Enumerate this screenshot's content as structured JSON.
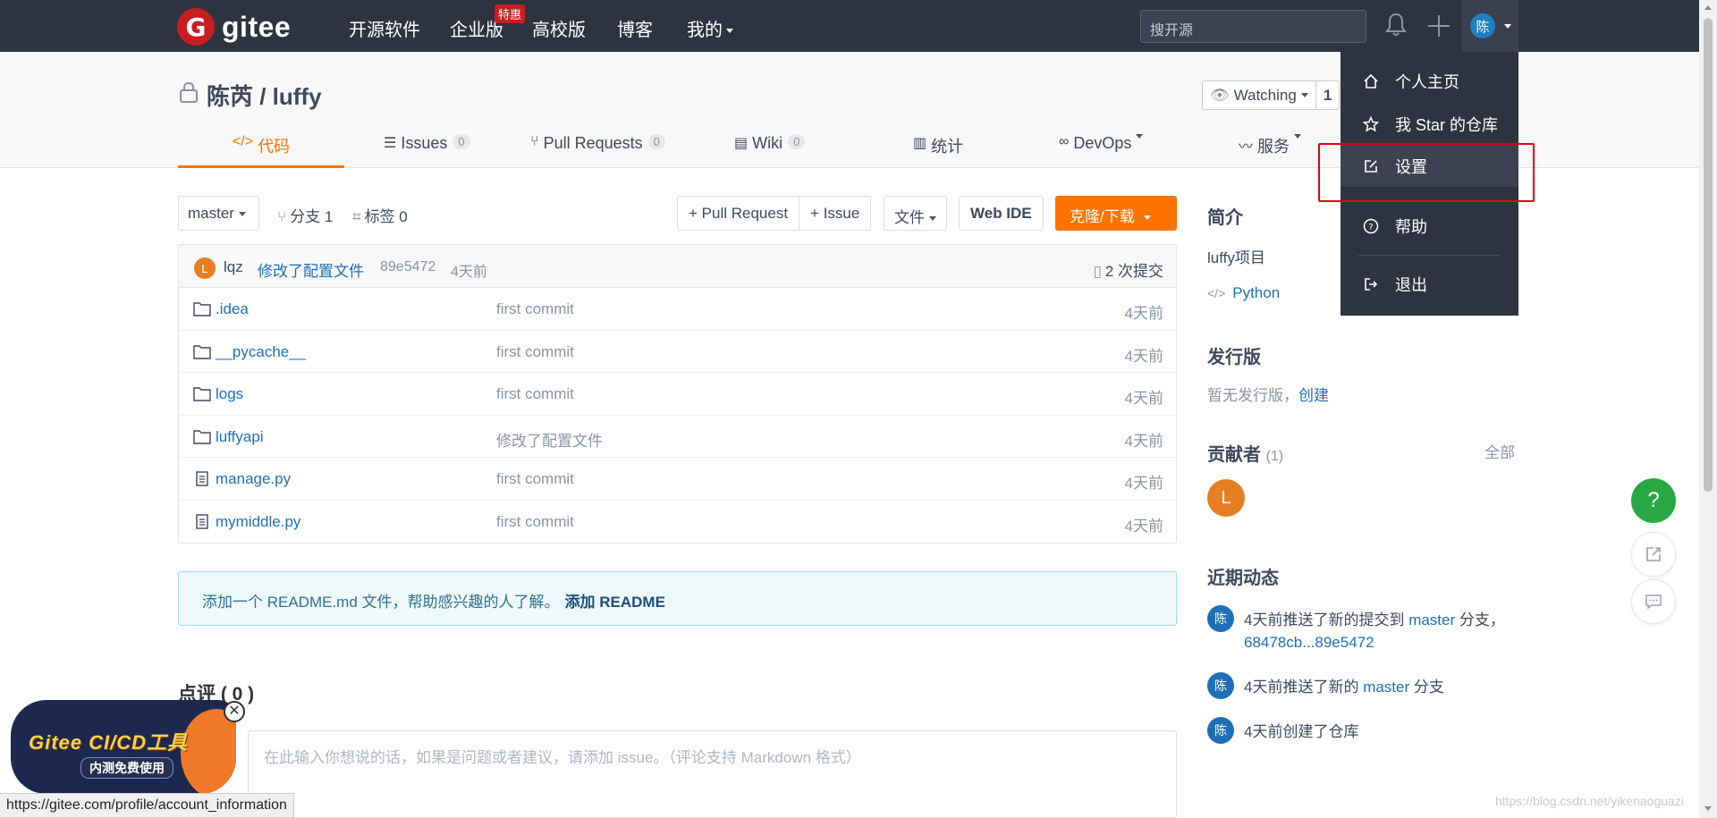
{
  "topnav": {
    "logo_text": "gitee",
    "logo_mark": "G",
    "items": [
      "开源软件",
      "企业版",
      "高校版",
      "博客",
      "我的"
    ],
    "enterprise_badge": "特惠",
    "search_placeholder": "搜开源",
    "user_avatar_char": "陈"
  },
  "repo": {
    "title": "陈芮 / luffy",
    "watch_label": "Watching",
    "watch_count": "1"
  },
  "tabs": [
    {
      "label": "代码",
      "icon": "code-icon"
    },
    {
      "label": "Issues",
      "count": "0",
      "icon": "issues-icon"
    },
    {
      "label": "Pull Requests",
      "count": "0",
      "icon": "pull-request-icon"
    },
    {
      "label": "Wiki",
      "count": "0",
      "icon": "wiki-icon"
    },
    {
      "label": "统计",
      "icon": "stats-icon"
    },
    {
      "label": "DevOps",
      "icon": "infinity-icon"
    },
    {
      "label": "服务",
      "icon": "pulse-icon"
    }
  ],
  "toolbar": {
    "branch": "master",
    "branches": "分支 1",
    "tags": "标签 0",
    "pull_request_btn": "+ Pull Request",
    "issue_btn": "+ Issue",
    "file_btn": "文件",
    "webide_btn": "Web IDE",
    "clone_btn": "克隆/下载"
  },
  "last_commit": {
    "avatar": "L",
    "author": "lqz",
    "message": "修改了配置文件",
    "hash": "89e5472",
    "time": "4天前",
    "count_label": "2 次提交"
  },
  "files": [
    {
      "name": ".idea",
      "type": "folder",
      "commit": "first commit",
      "time": "4天前"
    },
    {
      "name": "__pycache__",
      "type": "folder",
      "commit": "first commit",
      "time": "4天前"
    },
    {
      "name": "logs",
      "type": "folder",
      "commit": "first commit",
      "time": "4天前"
    },
    {
      "name": "luffyapi",
      "type": "folder",
      "commit": "修改了配置文件",
      "time": "4天前"
    },
    {
      "name": "manage.py",
      "type": "file",
      "commit": "first commit",
      "time": "4天前"
    },
    {
      "name": "mymiddle.py",
      "type": "file",
      "commit": "first commit",
      "time": "4天前"
    }
  ],
  "readme": {
    "text": "添加一个 README.md 文件，帮助感兴趣的人了解。",
    "link": "添加 README"
  },
  "comments": {
    "title": "点评 ( 0 )",
    "placeholder": "在此输入你想说的话，如果是问题或者建议，请添加 issue。（评论支持 Markdown 格式）"
  },
  "sidebar": {
    "intro_title": "简介",
    "intro_text": "luffy项目",
    "language": "Python",
    "release_title": "发行版",
    "release_text": "暂无发行版，",
    "release_link": "创建",
    "contrib_title": "贡献者",
    "contrib_count": "(1)",
    "contrib_all": "全部",
    "contrib_avatar": "L",
    "activity_title": "近期动态",
    "activities": [
      {
        "avatar": "陈",
        "pre": "4天前推送了新的提交到 ",
        "link": "master",
        "post": " 分支，",
        "link2": "68478cb...89e5472"
      },
      {
        "avatar": "陈",
        "pre": "4天前推送了新的 ",
        "link": "master",
        "post": " 分支",
        "link2": ""
      },
      {
        "avatar": "陈",
        "pre": "4天前创建了仓库",
        "link": "",
        "post": "",
        "link2": ""
      }
    ]
  },
  "user_menu": {
    "items": [
      "个人主页",
      "我 Star 的仓库",
      "设置",
      "帮助",
      "退出"
    ],
    "highlighted": "设置"
  },
  "promo": {
    "title": "Gitee CI/CD工具",
    "subtitle": "内测免费使用",
    "close": "✕"
  },
  "fab_help": "?",
  "status_url": "https://gitee.com/profile/account_information",
  "watermark": "https://blog.csdn.net/yikenaoguazi",
  "colors": {
    "accent": "#fe7300",
    "nav_bg": "#2e3340",
    "link": "#1e6fb8",
    "highlight_box": "#e5000f",
    "help_green": "#27a844"
  }
}
